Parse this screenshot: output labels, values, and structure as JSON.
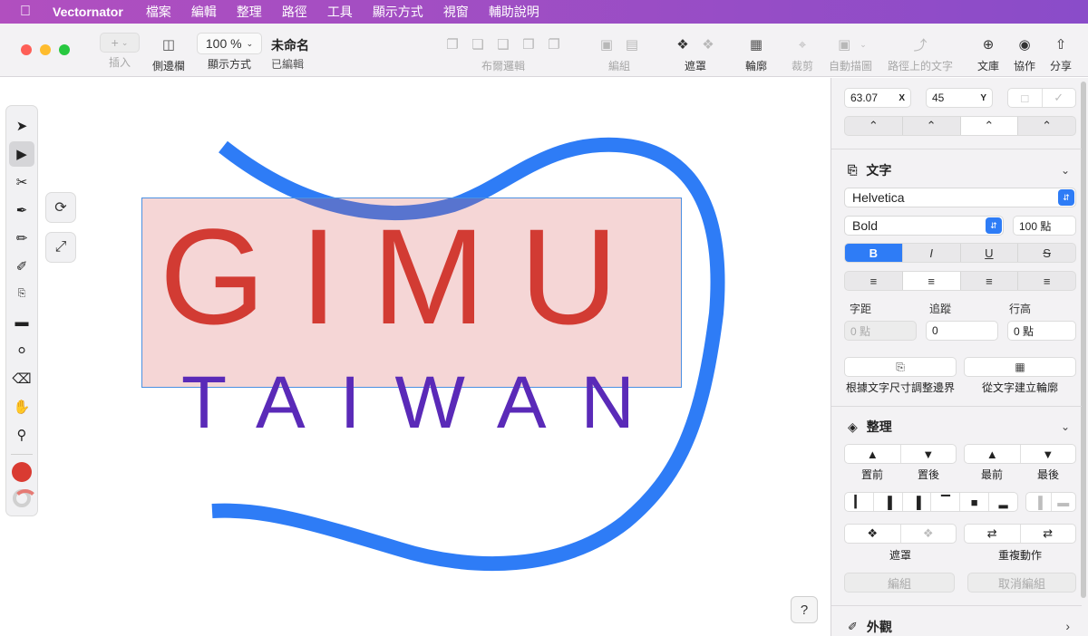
{
  "menubar": {
    "apple": "",
    "app_name": "Vectornator",
    "items": [
      "檔案",
      "編輯",
      "整理",
      "路徑",
      "工具",
      "顯示方式",
      "視窗",
      "輔助說明"
    ]
  },
  "toolbar": {
    "insert_label": "插入",
    "sidebar_label": "側邊欄",
    "zoom_value": "100 %",
    "view_label": "顯示方式",
    "doc_title": "未命名",
    "doc_status": "已編輯",
    "layout_label": "布爾邏輯",
    "group_label": "編組",
    "mask_label": "遮罩",
    "outline_label": "輪廓",
    "crop_label": "裁剪",
    "autotrace_label": "自動描圖",
    "text_on_path_label": "路徑上的文字",
    "library_label": "文庫",
    "collab_label": "協作",
    "share_label": "分享"
  },
  "canvas": {
    "text_main": "GIMU",
    "text_sub": "TAIWAN",
    "colors": {
      "main": "#d23b33",
      "sub": "#5a2ab8",
      "path": "#2e7cf6",
      "selection": "#4a90e2"
    }
  },
  "inspector": {
    "x_value": "63.07",
    "x_label": "X",
    "y_value": "45",
    "y_label": "Y",
    "text_section": "文字",
    "font_family": "Helvetica",
    "font_style": "Bold",
    "font_size": "100 點",
    "style_buttons": [
      "B",
      "I",
      "U",
      "S"
    ],
    "spacing_label": "字距",
    "tracking_label": "追蹤",
    "line_height_label": "行高",
    "spacing_value": "0 點",
    "tracking_value": "0",
    "line_height_value": "0 點",
    "fit_bounds_label": "根據文字尺寸調整邊界",
    "create_outline_label": "從文字建立輪廓",
    "arrange_section": "整理",
    "bring_forward": "置前",
    "send_backward": "置後",
    "bring_front": "最前",
    "send_back": "最後",
    "mask_label": "遮罩",
    "repeat_label": "重複動作",
    "group_button": "編組",
    "ungroup_button": "取消編組",
    "appearance_section": "外觀",
    "accent_color": "#2e7cf6"
  },
  "help": "?"
}
